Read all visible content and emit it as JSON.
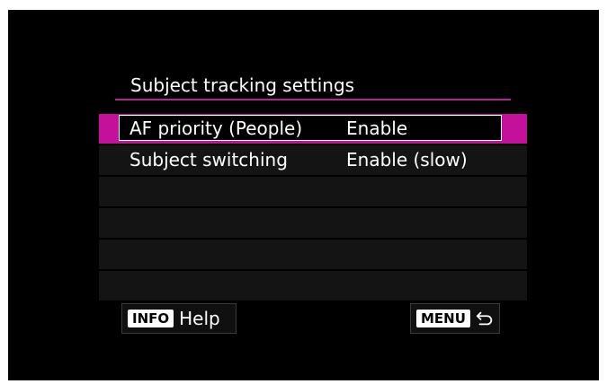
{
  "screen": {
    "title": "Subject tracking settings",
    "accent_color": "#c4109b"
  },
  "menu": {
    "items": [
      {
        "label": "AF priority (People)",
        "value": "Enable",
        "selected": true
      },
      {
        "label": "Subject switching",
        "value": "Enable (slow)",
        "selected": false
      },
      {
        "label": "",
        "value": "",
        "selected": false
      },
      {
        "label": "",
        "value": "",
        "selected": false
      },
      {
        "label": "",
        "value": "",
        "selected": false
      },
      {
        "label": "",
        "value": "",
        "selected": false
      }
    ]
  },
  "footer": {
    "info_key": "INFO",
    "info_label": "Help",
    "menu_key": "MENU",
    "back_icon": "return-arrow-icon"
  }
}
